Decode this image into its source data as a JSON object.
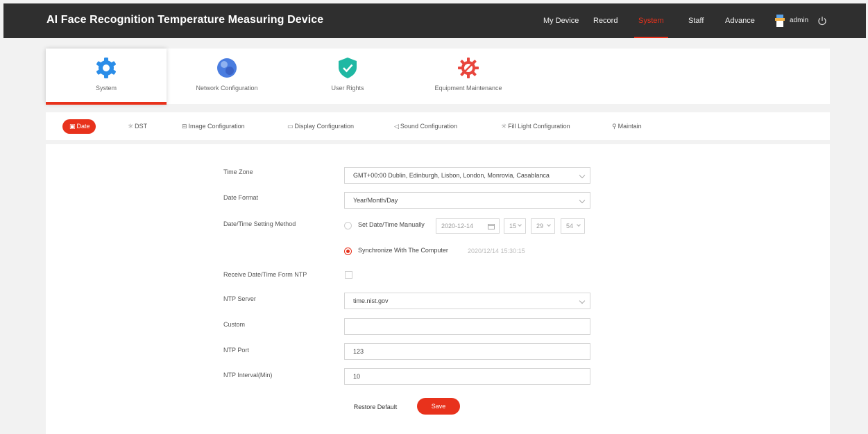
{
  "header": {
    "app_title": "AI Face Recognition Temperature Measuring Device",
    "nav": [
      "My Device",
      "Record",
      "System",
      "Staff",
      "Advance"
    ],
    "active_nav": "System",
    "user_name": "admin"
  },
  "categories": [
    "System",
    "Network Configuration",
    "User Rights",
    "Equipment Maintenance"
  ],
  "active_category": "System",
  "subtabs": [
    "Date",
    "DST",
    "Image Configuration",
    "Display Configuration",
    "Sound Configuration",
    "Fill Light Configuration",
    "Maintain"
  ],
  "active_subtab": "Date",
  "form": {
    "time_zone_label": "Time Zone",
    "time_zone_value": "GMT+00:00 Dublin, Edinburgh, Lisbon, London, Monrovia, Casablanca",
    "date_format_label": "Date Format",
    "date_format_value": "Year/Month/Day",
    "method_label": "Date/Time Setting Method",
    "manual_option": "Set Date/Time Manually",
    "manual_date": "2020-12-14",
    "manual_hour": "15",
    "manual_minute": "29",
    "manual_second": "54",
    "sync_option": "Synchronize With The Computer",
    "sync_value": "2020/12/14 15:30:15",
    "ntp_receive_label": "Receive Date/Time Form NTP",
    "ntp_server_label": "NTP Server",
    "ntp_server_value": "time.nist.gov",
    "custom_label": "Custom",
    "custom_value": "",
    "ntp_port_label": "NTP Port",
    "ntp_port_value": "123",
    "ntp_interval_label": "NTP Interval(Min)",
    "ntp_interval_value": "10",
    "restore_button": "Restore Default",
    "save_button": "Save"
  },
  "colors": {
    "accent": "#e8321c",
    "header_bg": "#2f2f2f"
  }
}
